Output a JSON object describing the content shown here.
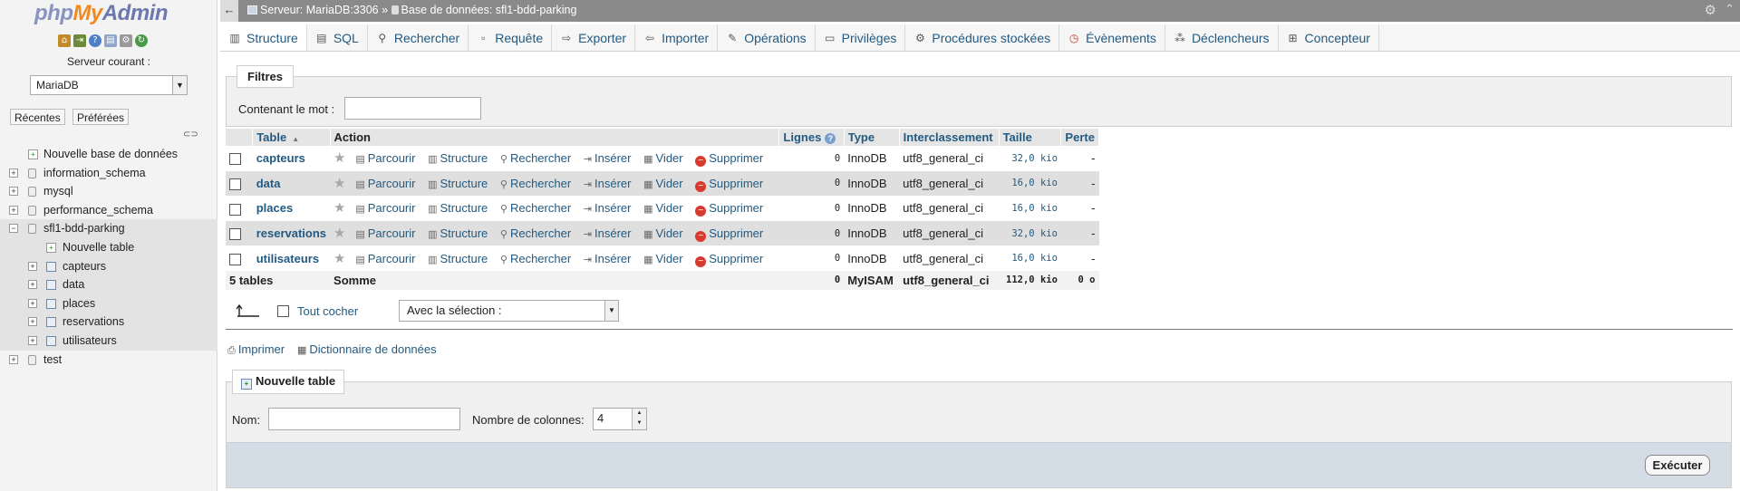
{
  "nav": {
    "logo": {
      "php": "php",
      "my": "My",
      "admin": "Admin"
    },
    "server_label": "Serveur courant :",
    "server_value": "MariaDB",
    "tabs": [
      "Récentes",
      "Préférées"
    ],
    "tree": [
      {
        "label": "Nouvelle base de données",
        "kind": "new"
      },
      {
        "label": "information_schema",
        "kind": "db"
      },
      {
        "label": "mysql",
        "kind": "db"
      },
      {
        "label": "performance_schema",
        "kind": "db"
      },
      {
        "label": "sfl1-bdd-parking",
        "kind": "db-open"
      },
      {
        "label": "Nouvelle table",
        "kind": "new-table"
      },
      {
        "label": "capteurs",
        "kind": "table"
      },
      {
        "label": "data",
        "kind": "table"
      },
      {
        "label": "places",
        "kind": "table"
      },
      {
        "label": "reservations",
        "kind": "table"
      },
      {
        "label": "utilisateurs",
        "kind": "table"
      },
      {
        "label": "test",
        "kind": "db"
      }
    ]
  },
  "topbar": {
    "server": "Serveur: MariaDB:3306",
    "sep": "»",
    "database": "Base de données: sfl1-bdd-parking"
  },
  "menu": [
    {
      "label": "Structure",
      "icon": "structure-icon"
    },
    {
      "label": "SQL",
      "icon": "sql-icon"
    },
    {
      "label": "Rechercher",
      "icon": "search-icon"
    },
    {
      "label": "Requête",
      "icon": "query-icon"
    },
    {
      "label": "Exporter",
      "icon": "export-icon"
    },
    {
      "label": "Importer",
      "icon": "import-icon"
    },
    {
      "label": "Opérations",
      "icon": "wrench-icon"
    },
    {
      "label": "Privilèges",
      "icon": "privileges-icon"
    },
    {
      "label": "Procédures stockées",
      "icon": "routines-icon"
    },
    {
      "label": "Évènements",
      "icon": "clock-icon"
    },
    {
      "label": "Déclencheurs",
      "icon": "triggers-icon"
    },
    {
      "label": "Concepteur",
      "icon": "designer-icon"
    }
  ],
  "filters": {
    "legend": "Filtres",
    "label": "Contenant le mot :",
    "value": ""
  },
  "table": {
    "headers": {
      "table": "Table",
      "action": "Action",
      "rows": "Lignes",
      "type": "Type",
      "collation": "Interclassement",
      "size": "Taille",
      "overhead": "Perte"
    },
    "actions": {
      "browse": "Parcourir",
      "structure": "Structure",
      "search": "Rechercher",
      "insert": "Insérer",
      "empty": "Vider",
      "drop": "Supprimer"
    },
    "rows": [
      {
        "name": "capteurs",
        "rows": "0",
        "type": "InnoDB",
        "collation": "utf8_general_ci",
        "size": "32,0 kio",
        "overhead": "-"
      },
      {
        "name": "data",
        "rows": "0",
        "type": "InnoDB",
        "collation": "utf8_general_ci",
        "size": "16,0 kio",
        "overhead": "-"
      },
      {
        "name": "places",
        "rows": "0",
        "type": "InnoDB",
        "collation": "utf8_general_ci",
        "size": "16,0 kio",
        "overhead": "-"
      },
      {
        "name": "reservations",
        "rows": "0",
        "type": "InnoDB",
        "collation": "utf8_general_ci",
        "size": "32,0 kio",
        "overhead": "-"
      },
      {
        "name": "utilisateurs",
        "rows": "0",
        "type": "InnoDB",
        "collation": "utf8_general_ci",
        "size": "16,0 kio",
        "overhead": "-"
      }
    ],
    "footer": {
      "count": "5 tables",
      "sum": "Somme",
      "rows": "0",
      "type": "MyISAM",
      "collation": "utf8_general_ci",
      "size": "112,0 kio",
      "overhead": "0 o"
    }
  },
  "bulk": {
    "check_all": "Tout cocher",
    "with_selection": "Avec la sélection :"
  },
  "links": {
    "print": "Imprimer",
    "dictionary": "Dictionnaire de données"
  },
  "new_table": {
    "legend": "Nouvelle table",
    "name_label": "Nom:",
    "name_value": "",
    "cols_label": "Nombre de colonnes:",
    "cols_value": "4",
    "execute": "Exécuter"
  },
  "colors": {
    "link": "#235a81",
    "logo_orange": "#f08a1e",
    "logo_blue": "#6c78af",
    "topbar": "#8a8a8a"
  }
}
